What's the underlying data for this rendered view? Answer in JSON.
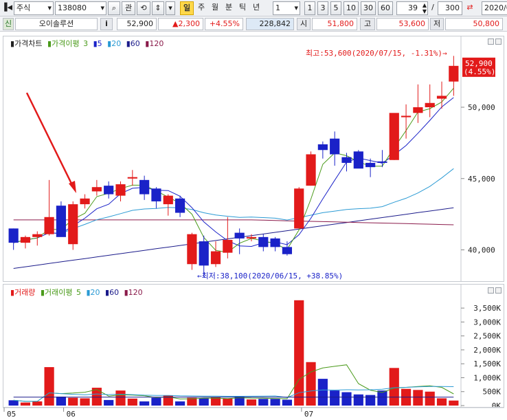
{
  "toolbar": {
    "market": "주식",
    "code": "138080",
    "watch": "관",
    "period_active": "일",
    "periods": [
      "주",
      "월",
      "분",
      "틱",
      "년"
    ],
    "interval_value": "1",
    "quick_counts": [
      "1",
      "3",
      "5",
      "10",
      "30",
      "60"
    ],
    "view_count": "39",
    "total_count": "300",
    "date_partial": "2020/0"
  },
  "info": {
    "credit_tag": "신",
    "name": "오이솔루션",
    "info_icon": "i",
    "price": "52,900",
    "change": "▲2,300",
    "change_pct": "+4.55%",
    "volume": "228,842",
    "open_label": "시",
    "open": "51,800",
    "high_label": "고",
    "high": "53,600",
    "low_label": "저",
    "low": "50,800"
  },
  "price_pane": {
    "legend": {
      "title": "가격차트",
      "ma_label": "가격이평",
      "ma_values": [
        "3",
        "5",
        "20",
        "60",
        "120"
      ]
    },
    "current_price": "52,900",
    "current_pct": "(4.55%)",
    "high_annotation": "최고:53,600(2020/07/15, -1.31%)→",
    "low_annotation": "←최저:38,100(2020/06/15, +38.85%)",
    "y_ticks": [
      "50,000",
      "45,000",
      "40,000"
    ]
  },
  "volume_pane": {
    "legend": {
      "title": "거래량",
      "ma_label": "거래이평",
      "ma_values": [
        "5",
        "20",
        "60",
        "120"
      ]
    },
    "y_ticks": [
      "3,500K",
      "3,000K",
      "2,500K",
      "2,000K",
      "1,500K",
      "1,000K",
      "500K",
      "0K"
    ]
  },
  "x_ticks": [
    "05",
    "06",
    "07"
  ],
  "colors": {
    "up": "#e21a1a",
    "down": "#1a22c8",
    "ma3": "#4a9a1a",
    "ma5": "#1a22c8",
    "ma20": "#2a9ad4",
    "ma60": "#1a1a8a",
    "ma120": "#8a1a4a",
    "accent": "#ffd84a"
  },
  "chart_data": {
    "type": "candlestick",
    "dates": [
      "2020-05-27",
      "2020-05-28",
      "2020-05-29",
      "2020-06-01",
      "2020-06-02",
      "2020-06-03",
      "2020-06-04",
      "2020-06-05",
      "2020-06-08",
      "2020-06-09",
      "2020-06-10",
      "2020-06-11",
      "2020-06-12",
      "2020-06-15",
      "2020-06-16",
      "2020-06-17",
      "2020-06-18",
      "2020-06-19",
      "2020-06-22",
      "2020-06-23",
      "2020-06-24",
      "2020-06-25",
      "2020-06-26",
      "2020-06-29",
      "2020-06-30",
      "2020-07-01",
      "2020-07-02",
      "2020-07-03",
      "2020-07-06",
      "2020-07-07",
      "2020-07-08",
      "2020-07-09",
      "2020-07-10",
      "2020-07-13",
      "2020-07-14",
      "2020-07-15"
    ],
    "ohlc": [
      [
        41.5,
        41.5,
        40.0,
        40.5
      ],
      [
        40.5,
        41.0,
        40.1,
        40.9
      ],
      [
        40.9,
        41.3,
        40.3,
        41.1
      ],
      [
        41.1,
        44.9,
        41.0,
        42.3
      ],
      [
        43.1,
        43.4,
        41.0,
        40.9
      ],
      [
        40.4,
        43.4,
        40.0,
        43.2
      ],
      [
        43.2,
        43.9,
        42.9,
        43.6
      ],
      [
        44.1,
        44.9,
        43.8,
        44.4
      ],
      [
        44.5,
        44.8,
        43.6,
        43.9
      ],
      [
        43.8,
        44.8,
        43.4,
        44.6
      ],
      [
        45.0,
        45.6,
        44.5,
        45.1
      ],
      [
        44.9,
        45.2,
        43.5,
        43.9
      ],
      [
        44.3,
        44.4,
        42.9,
        43.4
      ],
      [
        43.2,
        43.9,
        42.4,
        43.8
      ],
      [
        43.6,
        43.8,
        42.3,
        42.6
      ],
      [
        39.0,
        41.2,
        38.6,
        41.1
      ],
      [
        40.6,
        41.0,
        38.1,
        38.9
      ],
      [
        39.0,
        40.6,
        38.8,
        39.9
      ],
      [
        39.8,
        42.3,
        39.4,
        40.7
      ],
      [
        41.2,
        41.5,
        39.7,
        40.8
      ],
      [
        40.8,
        41.1,
        40.6,
        40.9
      ],
      [
        40.9,
        41.1,
        39.9,
        40.2
      ],
      [
        40.8,
        40.9,
        39.9,
        40.2
      ],
      [
        40.2,
        40.6,
        39.6,
        39.7
      ],
      [
        41.5,
        44.4,
        41.5,
        44.3
      ],
      [
        44.5,
        46.9,
        44.5,
        46.7
      ],
      [
        47.4,
        47.6,
        46.4,
        47.0
      ],
      [
        47.8,
        48.3,
        45.9,
        46.7
      ],
      [
        46.5,
        46.8,
        45.5,
        46.1
      ],
      [
        46.9,
        47.0,
        45.8,
        45.7
      ],
      [
        46.1,
        46.4,
        45.1,
        45.8
      ],
      [
        46.2,
        47.0,
        45.8,
        46.1
      ],
      [
        46.3,
        49.5,
        46.3,
        49.6
      ],
      [
        49.3,
        50.2,
        47.8,
        49.4
      ],
      [
        49.6,
        51.6,
        48.9,
        50.0
      ],
      [
        50.0,
        51.6,
        49.3,
        50.3
      ],
      [
        50.6,
        51.8,
        49.9,
        50.8
      ],
      [
        51.8,
        53.6,
        50.8,
        52.9
      ]
    ],
    "volume_k": [
      190,
      110,
      150,
      1380,
      320,
      280,
      260,
      640,
      200,
      540,
      250,
      150,
      280,
      360,
      150,
      280,
      260,
      300,
      250,
      320,
      220,
      240,
      240,
      210,
      3780,
      1560,
      960,
      540,
      480,
      400,
      380,
      540,
      1350,
      600,
      560,
      500,
      260,
      180
    ],
    "price_unit": "thousand KRW",
    "ylim_price": [
      38.0,
      54.0
    ],
    "ylim_volume_k": [
      0,
      3800
    ]
  }
}
